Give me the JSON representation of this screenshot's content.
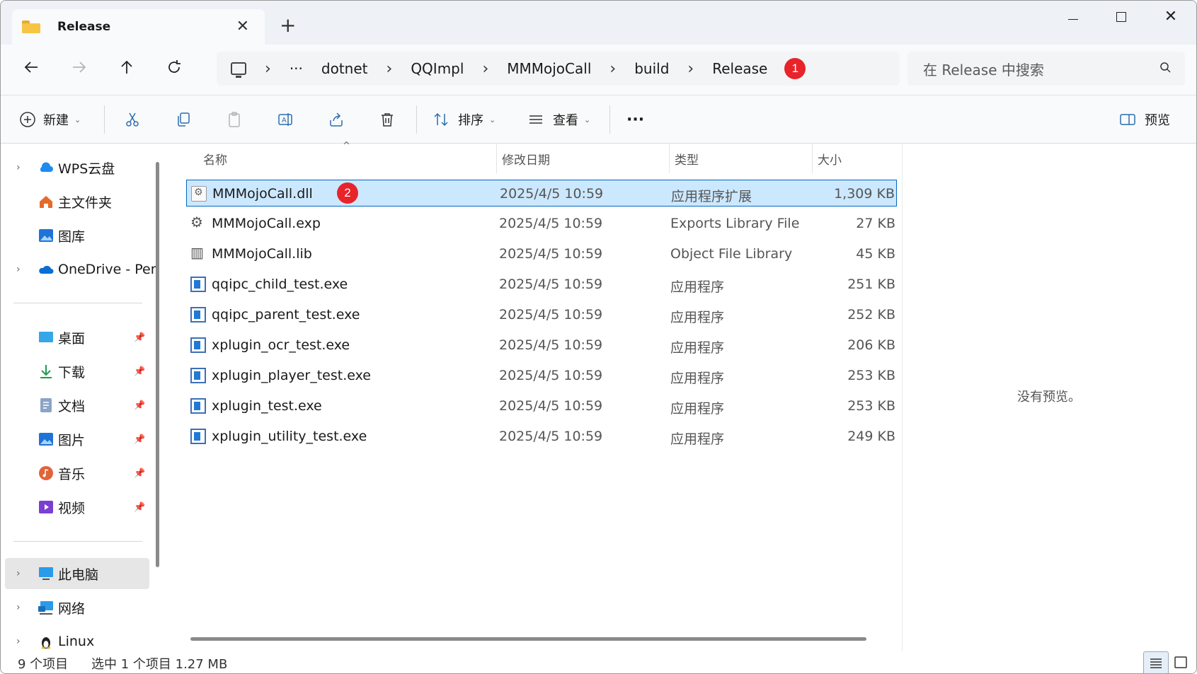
{
  "window": {
    "tab_title": "Release",
    "new_tab": "+",
    "tab_close": "✕"
  },
  "address": {
    "overflow": "···",
    "segments": [
      "dotnet",
      "QQImpl",
      "MMMojoCall",
      "build",
      "Release"
    ],
    "badge": "1"
  },
  "search": {
    "placeholder": "在 Release 中搜索"
  },
  "toolbar": {
    "new_label": "新建",
    "sort_label": "排序",
    "view_label": "查看",
    "more": "···",
    "preview_label": "预览"
  },
  "sidebar": {
    "items": [
      {
        "label": "WPS云盘",
        "icon": "cloud-icon"
      },
      {
        "label": "主文件夹",
        "icon": "home-icon"
      },
      {
        "label": "图库",
        "icon": "gallery-icon"
      },
      {
        "label": "OneDrive - Per",
        "icon": "onedrive-icon"
      },
      {
        "label": "桌面",
        "icon": "desktop-icon"
      },
      {
        "label": "下载",
        "icon": "download-icon"
      },
      {
        "label": "文档",
        "icon": "document-icon"
      },
      {
        "label": "图片",
        "icon": "pictures-icon"
      },
      {
        "label": "音乐",
        "icon": "music-icon"
      },
      {
        "label": "视频",
        "icon": "videos-icon"
      },
      {
        "label": "此电脑",
        "icon": "this-pc-icon"
      },
      {
        "label": "网络",
        "icon": "network-icon"
      },
      {
        "label": "Linux",
        "icon": "linux-icon"
      }
    ]
  },
  "columns": {
    "name": "名称",
    "date": "修改日期",
    "type": "类型",
    "size": "大小"
  },
  "files": [
    {
      "name": "MMMojoCall.dll",
      "date": "2025/4/5 10:59",
      "type": "应用程序扩展",
      "size": "1,309 KB",
      "icon": "dll-icon",
      "badge": "2"
    },
    {
      "name": "MMMojoCall.exp",
      "date": "2025/4/5 10:59",
      "type": "Exports Library File",
      "size": "27 KB",
      "icon": "exp-icon"
    },
    {
      "name": "MMMojoCall.lib",
      "date": "2025/4/5 10:59",
      "type": "Object File Library",
      "size": "45 KB",
      "icon": "lib-icon"
    },
    {
      "name": "qqipc_child_test.exe",
      "date": "2025/4/5 10:59",
      "type": "应用程序",
      "size": "251 KB",
      "icon": "exe-icon"
    },
    {
      "name": "qqipc_parent_test.exe",
      "date": "2025/4/5 10:59",
      "type": "应用程序",
      "size": "252 KB",
      "icon": "exe-icon"
    },
    {
      "name": "xplugin_ocr_test.exe",
      "date": "2025/4/5 10:59",
      "type": "应用程序",
      "size": "206 KB",
      "icon": "exe-icon"
    },
    {
      "name": "xplugin_player_test.exe",
      "date": "2025/4/5 10:59",
      "type": "应用程序",
      "size": "253 KB",
      "icon": "exe-icon"
    },
    {
      "name": "xplugin_test.exe",
      "date": "2025/4/5 10:59",
      "type": "应用程序",
      "size": "253 KB",
      "icon": "exe-icon"
    },
    {
      "name": "xplugin_utility_test.exe",
      "date": "2025/4/5 10:59",
      "type": "应用程序",
      "size": "249 KB",
      "icon": "exe-icon"
    }
  ],
  "preview": {
    "empty_text": "没有预览。"
  },
  "status": {
    "count": "9 个项目",
    "selection": "选中 1 个项目  1.27 MB"
  },
  "colors": {
    "selection_bg": "#cce8ff",
    "selection_border": "#0067c0",
    "badge": "#e8232a"
  }
}
